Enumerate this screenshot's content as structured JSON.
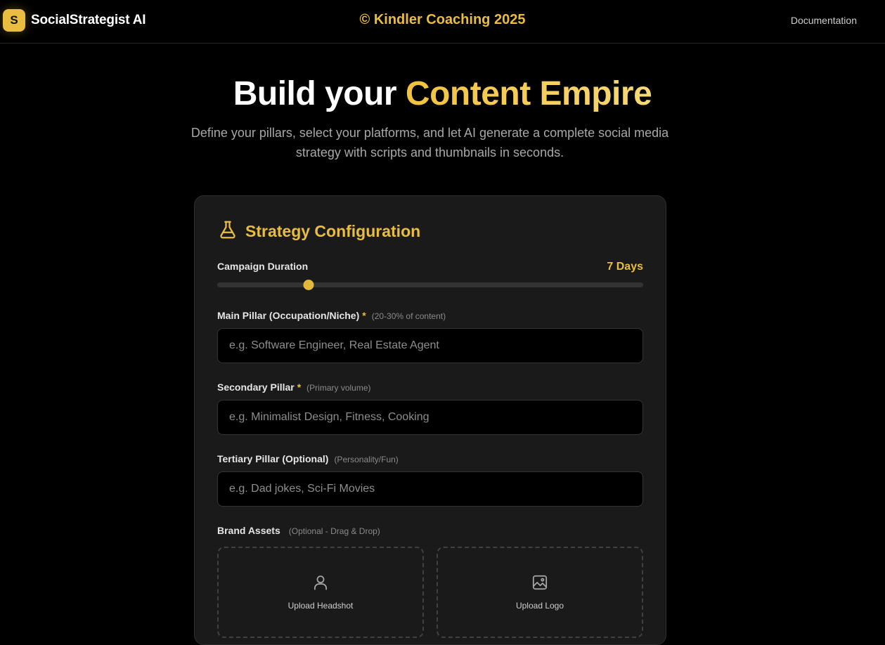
{
  "header": {
    "logo_letter": "S",
    "app_name": "SocialStrategist AI",
    "copyright": "© Kindler Coaching 2025",
    "documentation_link": "Documentation"
  },
  "hero": {
    "title_plain": "Build your ",
    "title_accent": "Content Empire",
    "subtitle": "Define your pillars, select your platforms, and let AI generate a complete social media strategy with scripts and thumbnails in seconds."
  },
  "config": {
    "title": "Strategy Configuration",
    "icon": "flask-icon",
    "duration": {
      "label": "Campaign Duration",
      "value_text": "7 Days",
      "level": 0.215
    },
    "main_pillar": {
      "label": "Main Pillar (Occupation/Niche)",
      "required_mark": "*",
      "hint": "(20-30% of content)",
      "value": "",
      "placeholder": "e.g. Software Engineer, Real Estate Agent"
    },
    "secondary_pillar": {
      "label": "Secondary Pillar",
      "required_mark": "*",
      "hint": "(Primary volume)",
      "value": "",
      "placeholder": "e.g. Minimalist Design, Fitness, Cooking"
    },
    "tertiary_pillar": {
      "label": "Tertiary Pillar (Optional)",
      "hint": "(Personality/Fun)",
      "value": "",
      "placeholder": "e.g. Dad jokes, Sci-Fi Movies"
    },
    "brand_assets": {
      "label": "Brand Assets",
      "hint": "(Optional - Drag & Drop)",
      "headshot_label": "Upload Headshot",
      "logo_label": "Upload Logo"
    }
  },
  "colors": {
    "accent": "#e9bd3f",
    "background": "#000000",
    "card": "#1a1a1a"
  }
}
